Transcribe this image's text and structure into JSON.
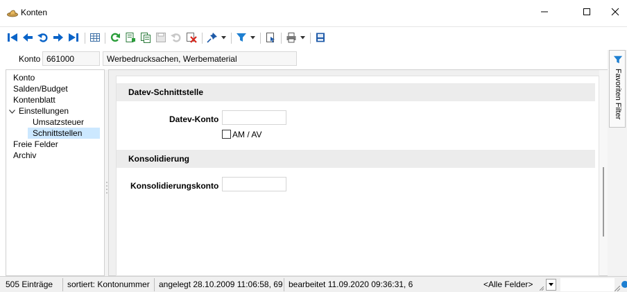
{
  "window": {
    "title": "Konten"
  },
  "toolbar": {
    "icons": [
      "first-record-icon",
      "prev-record-icon",
      "undo-icon",
      "next-record-icon",
      "last-record-icon",
      "grid-icon",
      "refresh-icon",
      "new-record-icon",
      "copy-icon",
      "save-icon",
      "revert-icon",
      "delete-icon",
      "pin-icon",
      "filter-icon",
      "report-icon",
      "print-icon",
      "layout-icon"
    ]
  },
  "konto": {
    "label": "Konto",
    "number": "661000",
    "description": "Werbedrucksachen, Werbematerial"
  },
  "tree": {
    "items": [
      {
        "label": "Konto"
      },
      {
        "label": "Salden/Budget"
      },
      {
        "label": "Kontenblatt"
      },
      {
        "label": "Einstellungen",
        "expanded": true
      },
      {
        "label": "Umsatzsteuer"
      },
      {
        "label": "Schnittstellen",
        "selected": true
      },
      {
        "label": "Freie Felder"
      },
      {
        "label": "Archiv"
      }
    ]
  },
  "form": {
    "datev_section": "Datev-Schnittstelle",
    "datev_konto_label": "Datev-Konto",
    "datev_konto_value": "",
    "am_av_label": "AM / AV",
    "am_av_checked": false,
    "konsolidierung_section": "Konsolidierung",
    "konsolidierungskonto_label": "Konsolidierungskonto",
    "konsolidierungskonto_value": ""
  },
  "side_tabs": {
    "label": "Favoriten Filter"
  },
  "status": {
    "count": "505 Einträge",
    "sorted": "sortiert: Kontonummer",
    "created": "angelegt 28.10.2009 11:06:58, 69",
    "edited": "bearbeitet 11.09.2020 09:36:31,  6",
    "field_filter": "<Alle Felder>"
  },
  "colors": {
    "accent_blue": "#0a64c8",
    "selection": "#cce8ff",
    "toolbar_green": "#2a9d3a",
    "delete_red": "#d9261c"
  }
}
